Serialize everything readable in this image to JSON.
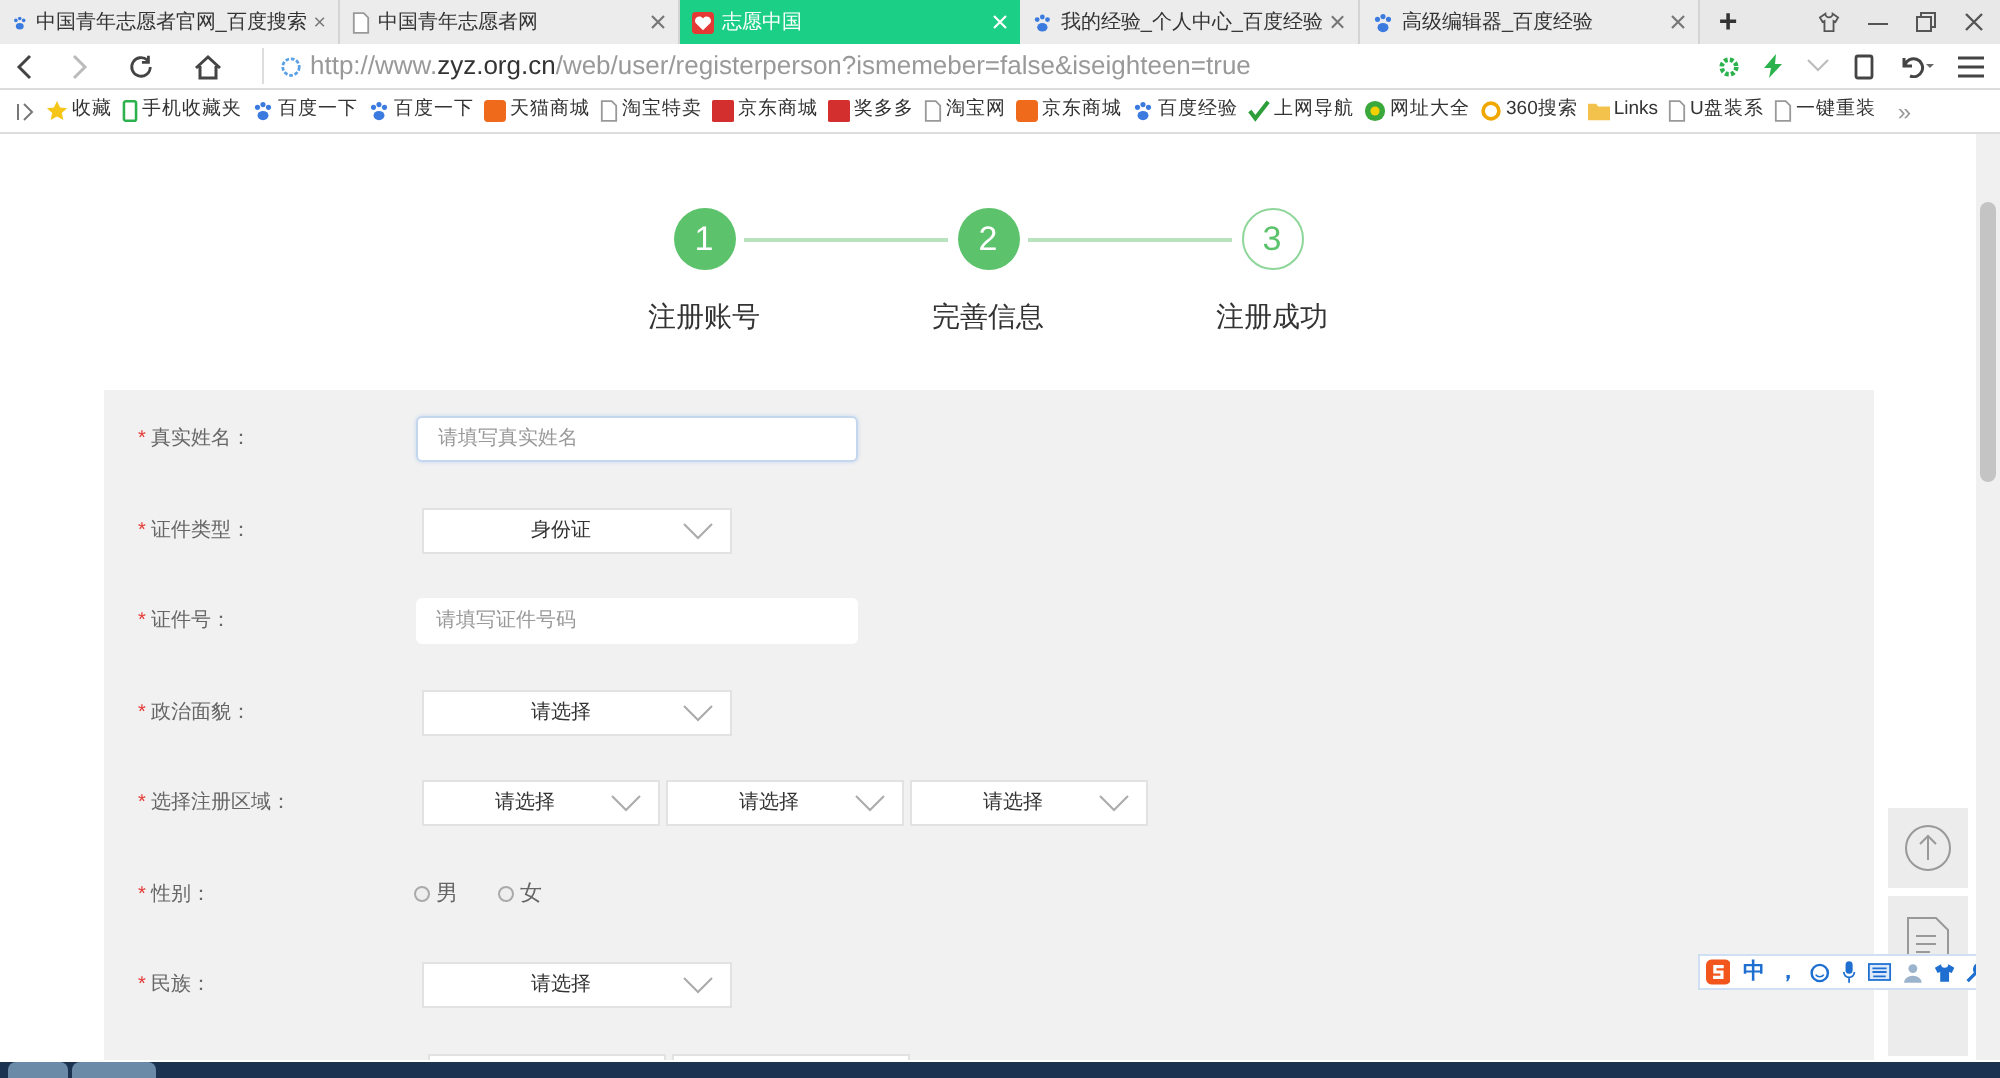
{
  "tabs": [
    {
      "title": "中国青年志愿者官网_百度搜索",
      "kind": "paw",
      "selected": false
    },
    {
      "title": "中国青年志愿者网",
      "kind": "page",
      "selected": false
    },
    {
      "title": "志愿中国",
      "kind": "heart",
      "selected": true
    },
    {
      "title": "我的经验_个人中心_百度经验",
      "kind": "paw",
      "selected": false
    },
    {
      "title": "高级编辑器_百度经验",
      "kind": "paw",
      "selected": false
    }
  ],
  "new_tab": "+",
  "address": {
    "scheme": "http://www.",
    "domain": "zyz.org.cn",
    "path": "/web/user/registerperson?ismemeber=false&iseighteen=true"
  },
  "bookmarks": [
    {
      "label": "收藏",
      "kind": "star"
    },
    {
      "label": "手机收藏夹",
      "kind": "phone"
    },
    {
      "label": "百度一下",
      "kind": "paw"
    },
    {
      "label": "百度一下",
      "kind": "paw"
    },
    {
      "label": "天猫商城",
      "kind": "orange"
    },
    {
      "label": "淘宝特卖",
      "kind": "page"
    },
    {
      "label": "京东商城",
      "kind": "red"
    },
    {
      "label": "奖多多",
      "kind": "red"
    },
    {
      "label": "淘宝网",
      "kind": "page"
    },
    {
      "label": "京东商城",
      "kind": "orange"
    },
    {
      "label": "百度经验",
      "kind": "paw"
    },
    {
      "label": "上网导航",
      "kind": "check"
    },
    {
      "label": "网址大全",
      "kind": "globe"
    },
    {
      "label": "360搜索",
      "kind": "ring"
    },
    {
      "label": "Links",
      "kind": "folder"
    },
    {
      "label": "U盘装系",
      "kind": "page"
    },
    {
      "label": "一键重装",
      "kind": "page"
    }
  ],
  "bookmarks_more": "»",
  "steps": [
    {
      "number": "1",
      "label": "注册账号",
      "done": true
    },
    {
      "number": "2",
      "label": "完善信息",
      "done": true
    },
    {
      "number": "3",
      "label": "注册成功",
      "done": false
    }
  ],
  "form": [
    {
      "required_mark": "*",
      "label": "真实姓名：",
      "kind": "text",
      "placeholder": "请填写真实姓名",
      "focused": true
    },
    {
      "required_mark": "*",
      "label": "证件类型：",
      "kind": "select",
      "values": [
        "身份证"
      ]
    },
    {
      "required_mark": "*",
      "label": "证件号：",
      "kind": "text",
      "placeholder": "请填写证件号码",
      "focused": false
    },
    {
      "required_mark": "*",
      "label": "政治面貌：",
      "kind": "select",
      "values": [
        "请选择"
      ]
    },
    {
      "required_mark": "*",
      "label": "选择注册区域：",
      "kind": "select3",
      "values": [
        "请选择",
        "请选择",
        "请选择"
      ]
    },
    {
      "required_mark": "*",
      "label": "性别：",
      "kind": "radio",
      "options": [
        {
          "label": "男",
          "selected": false
        },
        {
          "label": "女",
          "selected": false
        }
      ]
    },
    {
      "required_mark": "*",
      "label": "民族：",
      "kind": "select",
      "values": [
        "请选择"
      ]
    }
  ],
  "ime": {
    "mode": "中",
    "punct": "，"
  }
}
